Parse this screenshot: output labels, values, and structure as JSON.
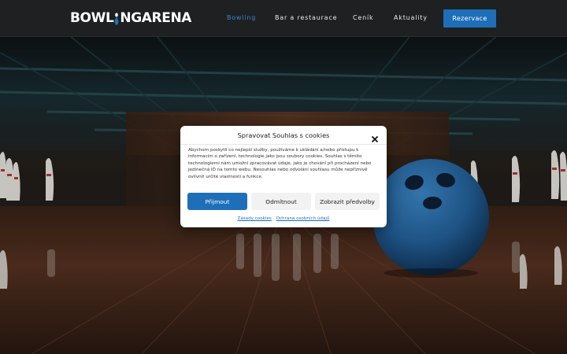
{
  "header": {
    "logo": {
      "part1": "BOWL",
      "part2": "NGARENA",
      "alt": "BOWLINGARENA"
    },
    "nav": [
      {
        "label": "Bowling",
        "active": true
      },
      {
        "label": "Bar a restaurace",
        "active": false
      },
      {
        "label": "Ceník",
        "active": false
      },
      {
        "label": "Aktuality",
        "active": false
      }
    ],
    "cta_label": "Rezervace"
  },
  "colors": {
    "accent": "#1e6fb8",
    "nav_active": "#3d86cc",
    "header_bg": "#1e2022"
  },
  "cookie_modal": {
    "title": "Spravovat Souhlas s cookies",
    "body": "Abychom poskytli co nejlepší služby, používáme k ukládání a/nebo přístupu k informacím o zařízení, technologie jako jsou soubory cookies. Souhlas s těmito technologiemi nám umožní zpracovávat údaje, jako je chování při procházení nebo jedinečná ID na tomto webu. Nesouhlas nebo odvolání souhlasu může nepříznivě ovlivnit určité vlastnosti a funkce.",
    "accept_label": "Přijmout",
    "deny_label": "Odmítnout",
    "preferences_label": "Zobrazit předvolby",
    "links": [
      {
        "label": "Zásady cookies"
      },
      {
        "label": "Ochrana osobních údajů"
      }
    ],
    "close_icon": "close-icon"
  },
  "hero": {
    "image": "bowling-alley-background",
    "ball_color": "#2a6fae"
  }
}
